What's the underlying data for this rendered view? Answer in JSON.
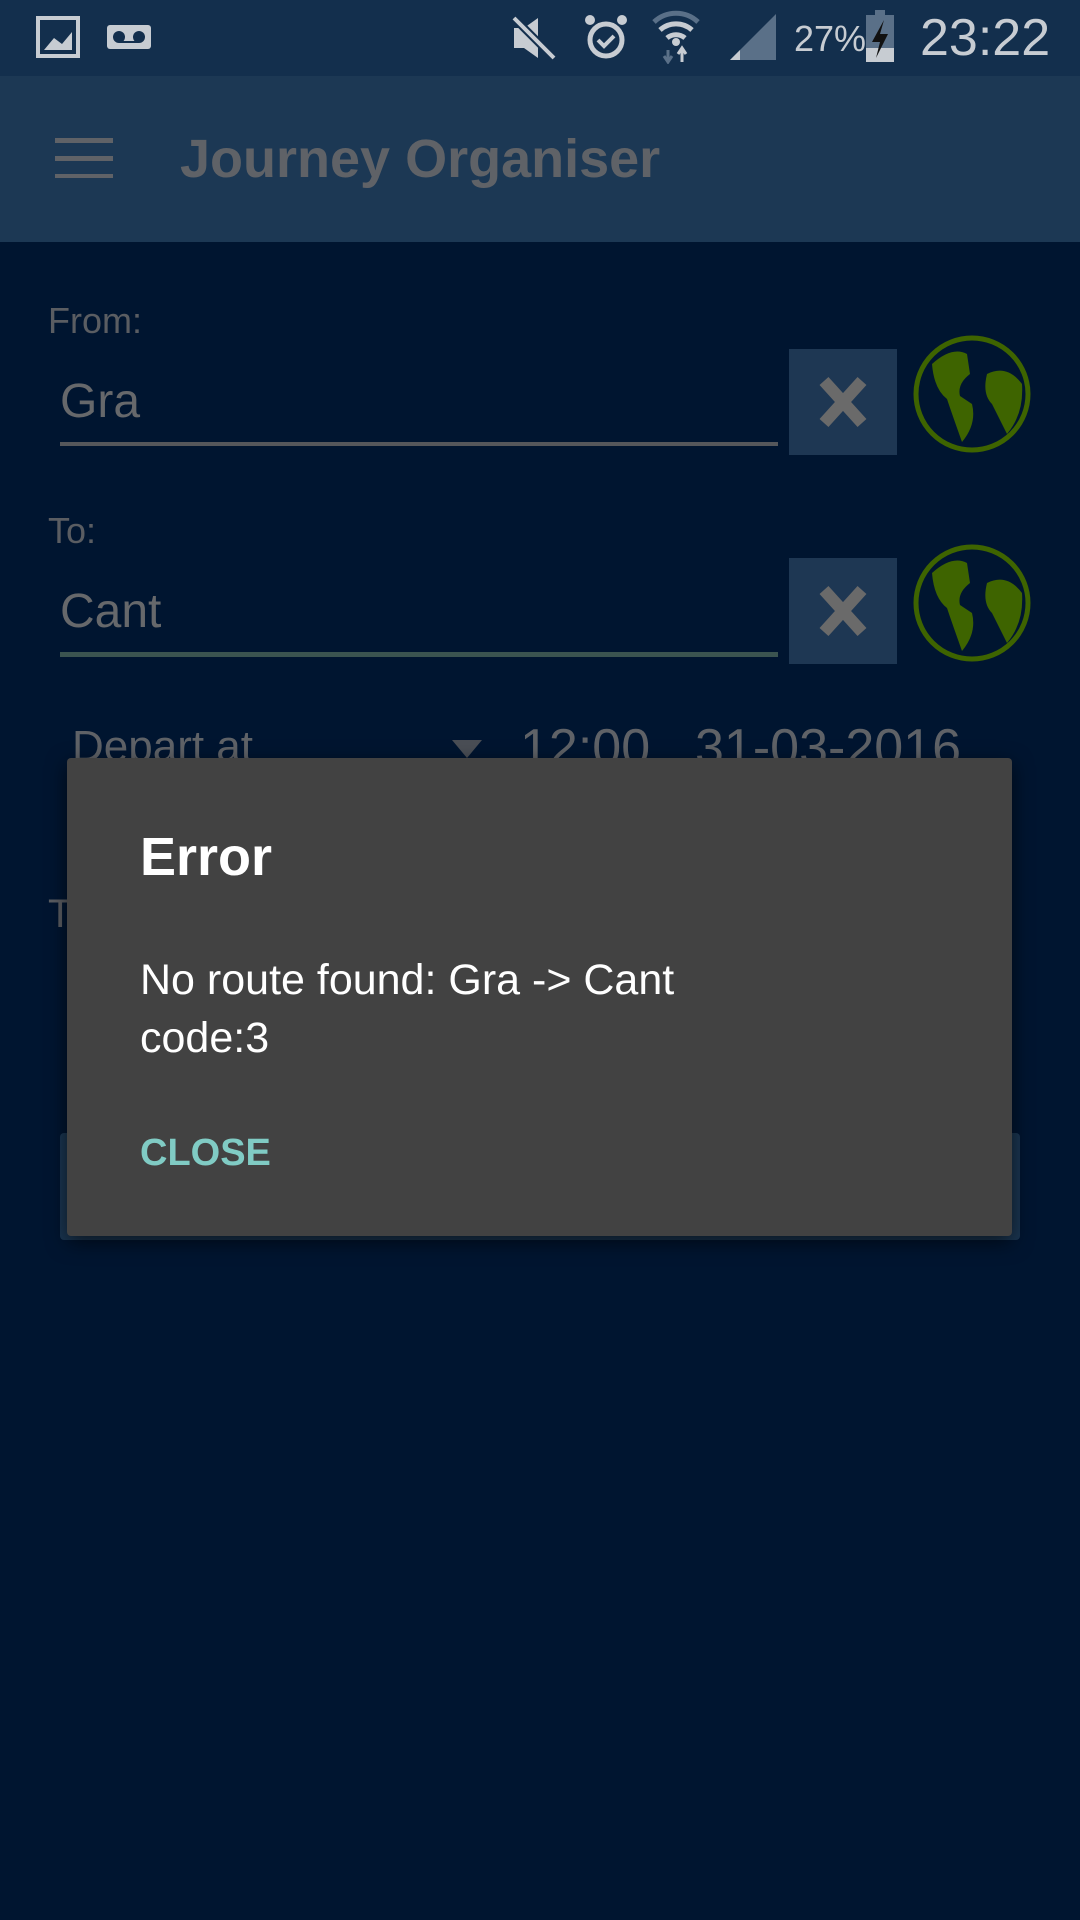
{
  "status_bar": {
    "battery": "27%",
    "time": "23:22",
    "icons": [
      "gallery-icon",
      "voicemail-icon",
      "mute-icon",
      "alarm-icon",
      "wifi-icon",
      "signal-icon",
      "battery-charging-icon"
    ]
  },
  "app_bar": {
    "title": "Journey Organiser",
    "menu_icon": "hamburger-menu-icon"
  },
  "form": {
    "from": {
      "label": "From:",
      "value": "Gra"
    },
    "to": {
      "label": "To:",
      "value": "Cant"
    },
    "depart": {
      "mode": "Depart at",
      "time": "12:00",
      "date": "31-03-2016"
    },
    "hidden_label_partial": "T"
  },
  "dialog": {
    "title": "Error",
    "message": "No route found: Gra -> Cant",
    "code": "code:3",
    "close_label": "CLOSE"
  },
  "colors": {
    "accent": "#80cbc4",
    "globe": "#3e6400",
    "dialog": "#424242"
  }
}
